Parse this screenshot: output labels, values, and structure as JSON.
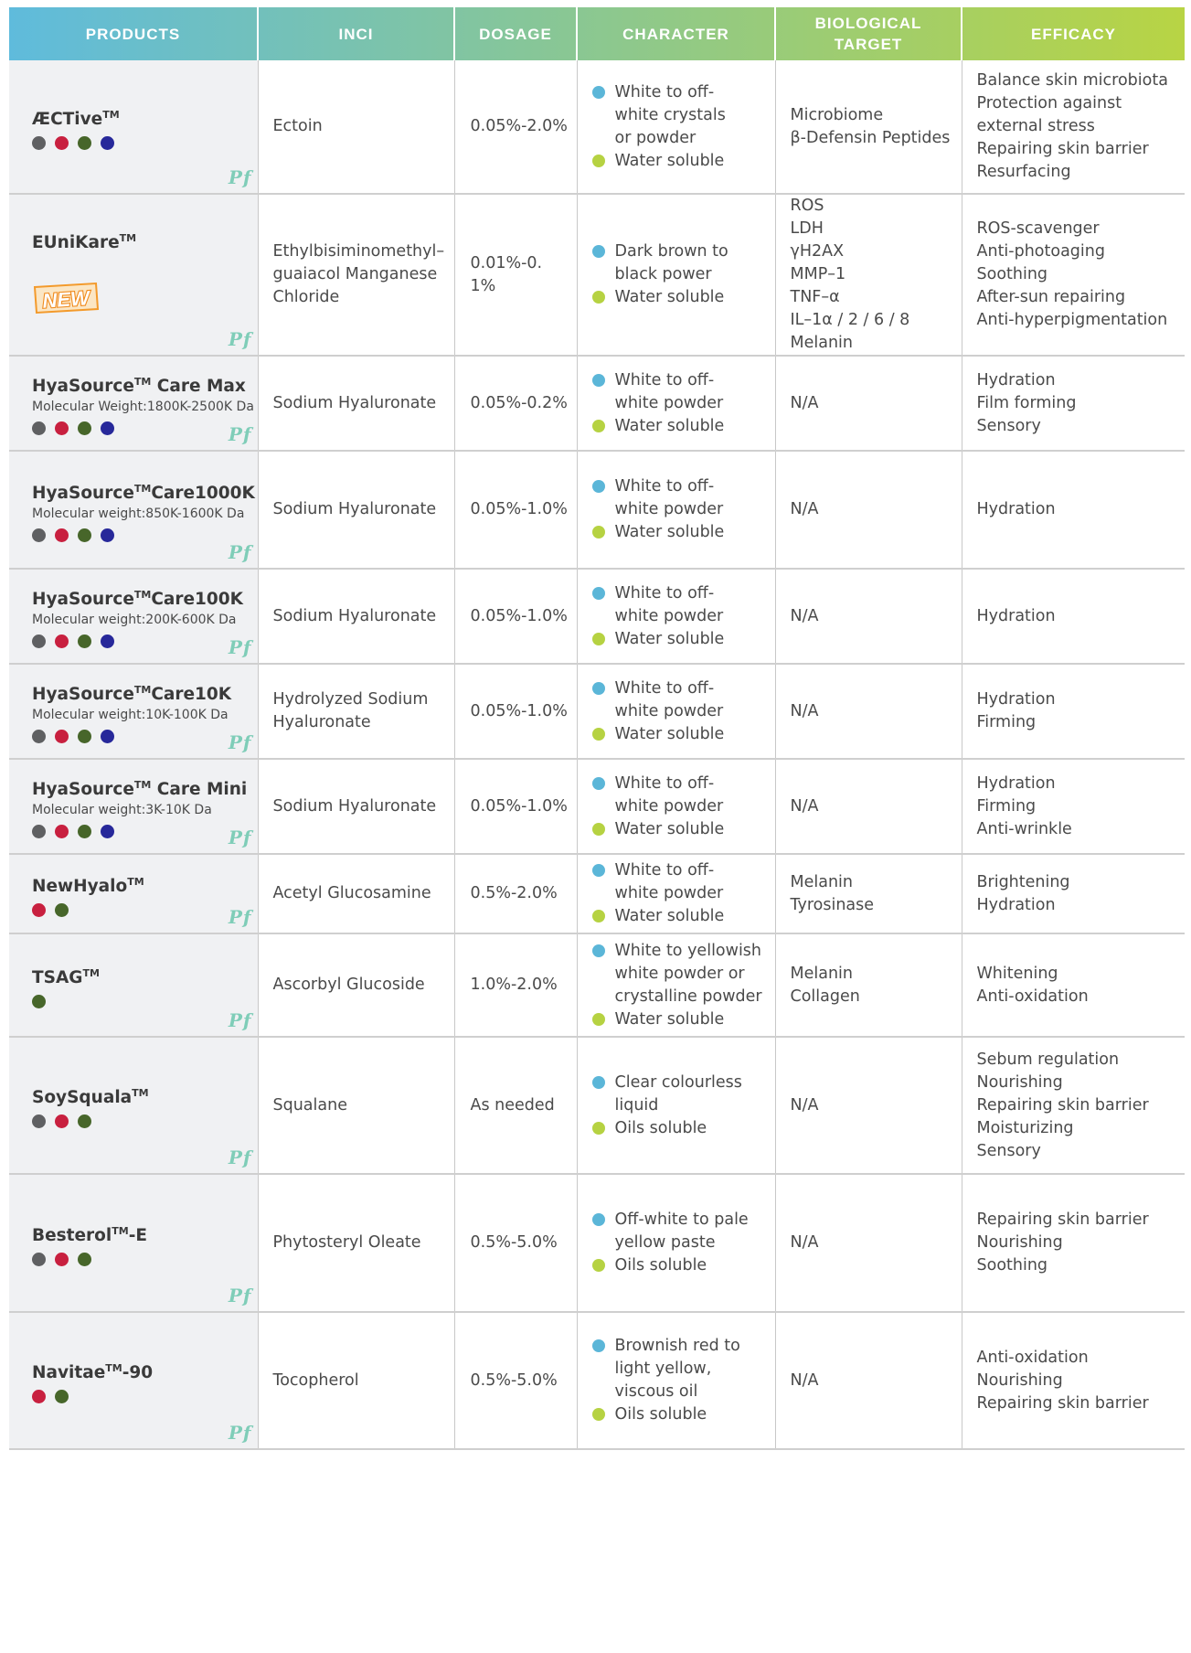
{
  "colors": {
    "header_gradient": [
      "#5fbbdc",
      "#b8d444"
    ],
    "bullet_appearance": "#5bb6d8",
    "bullet_solubility": "#b6d242",
    "pf_mark": "#7fcdb8",
    "dot_palette": {
      "gray": "#5f6062",
      "red": "#c8203f",
      "green": "#47662a",
      "navy": "#27289a"
    }
  },
  "header": {
    "products": "PRODUCTS",
    "inci": "INCI",
    "dosage": "DOSAGE",
    "character": "CHARACTER",
    "target": "BIOLOGICAL TARGET",
    "efficacy": "EFFICACY"
  },
  "pf_mark": "Pf",
  "new_badge": "NEW",
  "rows": [
    {
      "name": "ÆCTive",
      "tm": "TM",
      "suffix": "",
      "mw": "",
      "dots": [
        "#5f6062",
        "#c8203f",
        "#47662a",
        "#27289a"
      ],
      "inci": [
        "Ectoin"
      ],
      "dosage": "0.05%-2.0%",
      "appearance": [
        "White to off-",
        "white crystals",
        "or powder"
      ],
      "solubility": "Water soluble",
      "target": [
        "Microbiome",
        "β-Defensin Peptides"
      ],
      "efficacy": [
        "Balance skin microbiota",
        "Protection against",
        "external stress",
        "Repairing skin barrier",
        "Resurfacing"
      ],
      "height": 146
    },
    {
      "name": "EUniKare",
      "tm": "TM",
      "suffix": "",
      "mw": "",
      "is_new": true,
      "dots": [],
      "inci": [
        "Ethylbisiminomethyl–",
        "guaiacol Manganese",
        "Chloride"
      ],
      "dosage": "0.01%-0. 1%",
      "appearance": [
        "Dark brown to",
        "black power"
      ],
      "solubility": "Water soluble",
      "target": [
        "ROS",
        "LDH",
        "γH2AX",
        "MMP–1",
        "TNF–α",
        "IL–1α / 2 / 6 / 8",
        "Melanin"
      ],
      "efficacy": [
        "ROS-scavenger",
        "Anti-photoaging",
        "Soothing",
        "After-sun repairing",
        "Anti-hyperpigmentation"
      ],
      "height": 173
    },
    {
      "name": "HyaSource",
      "tm": "TM",
      "suffix": " Care Max",
      "mw": "Molecular Weight:1800K-2500K Da",
      "dots": [
        "#5f6062",
        "#c8203f",
        "#47662a",
        "#27289a"
      ],
      "inci": [
        "Sodium Hyaluronate"
      ],
      "dosage": "0.05%-0.2%",
      "appearance": [
        "White to off-",
        "white powder"
      ],
      "solubility": "Water soluble",
      "target": [
        "N/A"
      ],
      "efficacy": [
        "Hydration",
        "Film forming",
        "Sensory"
      ],
      "height": 104
    },
    {
      "name": "HyaSource",
      "tm": "TM",
      "suffix": "Care1000K",
      "mw": "Molecular weight:850K-1600K Da",
      "dots": [
        "#5f6062",
        "#c8203f",
        "#47662a",
        "#27289a"
      ],
      "inci": [
        "Sodium Hyaluronate"
      ],
      "dosage": "0.05%-1.0%",
      "appearance": [
        "White to off-",
        "white powder"
      ],
      "solubility": "Water soluble",
      "target": [
        "N/A"
      ],
      "efficacy": [
        "Hydration"
      ],
      "height": 129
    },
    {
      "name": "HyaSource",
      "tm": "TM",
      "suffix": "Care100K",
      "mw": "Molecular weight:200K-600K Da",
      "dots": [
        "#5f6062",
        "#c8203f",
        "#47662a",
        "#27289a"
      ],
      "inci": [
        "Sodium Hyaluronate"
      ],
      "dosage": "0.05%-1.0%",
      "appearance": [
        "White to off-",
        "white powder"
      ],
      "solubility": "Water soluble",
      "target": [
        "N/A"
      ],
      "efficacy": [
        "Hydration"
      ],
      "height": 104
    },
    {
      "name": "HyaSource",
      "tm": "TM",
      "suffix": "Care10K",
      "mw": "Molecular weight:10K-100K Da",
      "dots": [
        "#5f6062",
        "#c8203f",
        "#47662a",
        "#27289a"
      ],
      "inci": [
        "Hydrolyzed Sodium",
        "Hyaluronate"
      ],
      "dosage": "0.05%-1.0%",
      "appearance": [
        "White to off-",
        "white powder"
      ],
      "solubility": "Water soluble",
      "target": [
        "N/A"
      ],
      "efficacy": [
        "Hydration",
        "Firming"
      ],
      "height": 104
    },
    {
      "name": "HyaSource",
      "tm": "TM",
      "suffix": " Care Mini",
      "mw": "Molecular weight:3K-10K Da",
      "dots": [
        "#5f6062",
        "#c8203f",
        "#47662a",
        "#27289a"
      ],
      "inci": [
        "Sodium Hyaluronate"
      ],
      "dosage": "0.05%-1.0%",
      "appearance": [
        "White to off-",
        "white powder"
      ],
      "solubility": "Water soluble",
      "target": [
        "N/A"
      ],
      "efficacy": [
        "Hydration",
        "Firming",
        "Anti-wrinkle"
      ],
      "height": 104
    },
    {
      "name": "NewHyalo",
      "tm": "TM",
      "suffix": "",
      "mw": "",
      "dots": [
        "#c8203f",
        "#47662a"
      ],
      "inci": [
        "Acetyl Glucosamine"
      ],
      "dosage": "0.5%-2.0%",
      "appearance": [
        "White to off-",
        "white powder"
      ],
      "solubility": "Water soluble",
      "target": [
        "Melanin",
        "Tyrosinase"
      ],
      "efficacy": [
        "Brightening",
        "Hydration"
      ],
      "height": 87
    },
    {
      "name": "TSAG",
      "tm": "TM",
      "suffix": "",
      "mw": "",
      "dots": [
        "#47662a"
      ],
      "inci": [
        "Ascorbyl Glucoside"
      ],
      "dosage": "1.0%-2.0%",
      "appearance": [
        "White to yellowish",
        "white powder or",
        "crystalline powder"
      ],
      "solubility": "Water soluble",
      "target": [
        "Melanin",
        "Collagen"
      ],
      "efficacy": [
        "Whitening",
        "Anti-oxidation"
      ],
      "height": 113
    },
    {
      "name": "SoySquala",
      "tm": "TM",
      "suffix": "",
      "mw": "",
      "dots": [
        "#5f6062",
        "#c8203f",
        "#47662a"
      ],
      "inci": [
        "Squalane"
      ],
      "dosage": "As  needed",
      "appearance": [
        "Clear colourless",
        "liquid"
      ],
      "solubility": "Oils soluble",
      "target": [
        "N/A"
      ],
      "efficacy": [
        "Sebum regulation",
        "Nourishing",
        "Repairing skin barrier",
        "Moisturizing",
        "Sensory"
      ],
      "height": 150
    },
    {
      "name": "Besterol",
      "tm": "TM",
      "suffix": "-E",
      "mw": "",
      "dots": [
        "#5f6062",
        "#c8203f",
        "#47662a"
      ],
      "inci": [
        "Phytosteryl Oleate"
      ],
      "dosage": "0.5%-5.0%",
      "appearance": [
        "Off-white to pale",
        "yellow paste"
      ],
      "solubility": "Oils soluble",
      "target": [
        "N/A"
      ],
      "efficacy": [
        "Repairing skin barrier",
        "Nourishing",
        "Soothing"
      ],
      "height": 151
    },
    {
      "name": "Navitae",
      "tm": "TM",
      "suffix": "-90",
      "mw": "",
      "dots": [
        "#c8203f",
        "#47662a"
      ],
      "inci": [
        "Tocopherol"
      ],
      "dosage": "0.5%-5.0%",
      "appearance": [
        "Brownish red to",
        "light yellow,",
        "viscous oil"
      ],
      "solubility": "Oils soluble",
      "target": [
        "N/A"
      ],
      "efficacy": [
        "Anti-oxidation",
        "Nourishing",
        "Repairing skin barrier"
      ],
      "height": 150
    }
  ]
}
